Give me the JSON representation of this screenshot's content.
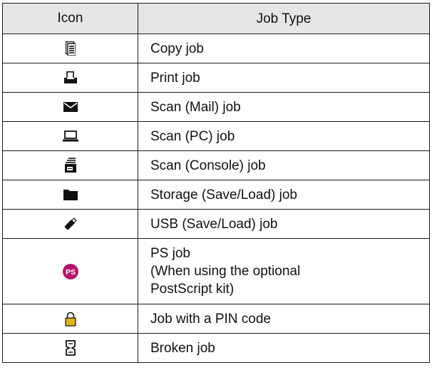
{
  "table": {
    "header": {
      "icon": "Icon",
      "job_type": "Job Type"
    },
    "rows": [
      {
        "icon": "copy-job-icon",
        "label": "Copy job"
      },
      {
        "icon": "print-job-icon",
        "label": "Print job"
      },
      {
        "icon": "mail-icon",
        "label": "Scan (Mail) job"
      },
      {
        "icon": "laptop-icon",
        "label": "Scan (PC) job"
      },
      {
        "icon": "scan-console-icon",
        "label": "Scan (Console) job"
      },
      {
        "icon": "folder-icon",
        "label": "Storage (Save/Load) job"
      },
      {
        "icon": "usb-icon",
        "label": "USB (Save/Load) job"
      },
      {
        "icon": "ps-icon",
        "label": "PS job\n(When using the optional\nPostScript kit)",
        "badge_text": "PS"
      },
      {
        "icon": "lock-icon",
        "label": "Job with a PIN code"
      },
      {
        "icon": "broken-job-icon",
        "label": "Broken job"
      }
    ],
    "colors": {
      "header_bg": "#e6e6e6",
      "border": "#1a1a1a",
      "ps_badge": "#b5166b",
      "lock_gold": "#e0b21b"
    }
  }
}
